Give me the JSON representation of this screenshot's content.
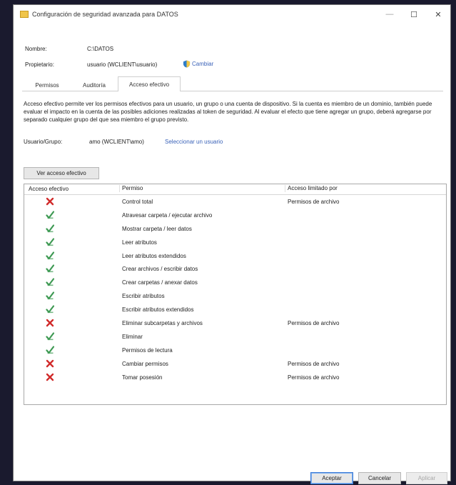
{
  "window": {
    "title": "Configuración de seguridad avanzada para DATOS",
    "minimize": "—",
    "maximize": "☐",
    "close": "✕"
  },
  "info": {
    "name_label": "Nombre:",
    "name_value": "C:\\DATOS",
    "owner_label": "Propietario:",
    "owner_value": "usuario (WCLIENT\\usuario)",
    "owner_change_link": "Cambiar"
  },
  "tabs": [
    {
      "label": "Permisos"
    },
    {
      "label": "Auditoría"
    },
    {
      "label": "Acceso efectivo"
    }
  ],
  "description": "Acceso efectivo permite ver los permisos efectivos para un usuario, un grupo o una cuenta de dispositivo. Si la cuenta es miembro de un dominio, también puede evaluar el impacto en la cuenta de las posibles adiciones realizadas al token de seguridad. Al evaluar el efecto que tiene agregar un grupo, deberá agregarse por separado cualquier grupo del que sea miembro el grupo previsto.",
  "user": {
    "label": "Usuario/Grupo:",
    "value": "amo (WCLIENT\\amo)",
    "select_link": "Seleccionar un usuario"
  },
  "view_button": "Ver acceso efectivo",
  "table": {
    "columns": [
      "Acceso efectivo",
      "Permiso",
      "Acceso limitado por"
    ],
    "rows": [
      {
        "allowed": false,
        "permission": "Control total",
        "limited_by": "Permisos de archivo"
      },
      {
        "allowed": true,
        "permission": "Atravesar carpeta / ejecutar archivo",
        "limited_by": ""
      },
      {
        "allowed": true,
        "permission": "Mostrar carpeta / leer datos",
        "limited_by": ""
      },
      {
        "allowed": true,
        "permission": "Leer atributos",
        "limited_by": ""
      },
      {
        "allowed": true,
        "permission": "Leer atributos extendidos",
        "limited_by": ""
      },
      {
        "allowed": true,
        "permission": "Crear archivos / escribir datos",
        "limited_by": ""
      },
      {
        "allowed": true,
        "permission": "Crear carpetas / anexar datos",
        "limited_by": ""
      },
      {
        "allowed": true,
        "permission": "Escribir atributos",
        "limited_by": ""
      },
      {
        "allowed": true,
        "permission": "Escribir atributos extendidos",
        "limited_by": ""
      },
      {
        "allowed": false,
        "permission": "Eliminar subcarpetas y archivos",
        "limited_by": "Permisos de archivo"
      },
      {
        "allowed": true,
        "permission": "Eliminar",
        "limited_by": ""
      },
      {
        "allowed": true,
        "permission": "Permisos de lectura",
        "limited_by": ""
      },
      {
        "allowed": false,
        "permission": "Cambiar permisos",
        "limited_by": "Permisos de archivo"
      },
      {
        "allowed": false,
        "permission": "Tomar posesión",
        "limited_by": "Permisos de archivo"
      }
    ]
  },
  "footer": {
    "accept": "Aceptar",
    "cancel": "Cancelar",
    "apply": "Aplicar"
  },
  "colors": {
    "deny": "#d12b2b",
    "allow": "#3f9a54",
    "link": "#3a62b8"
  },
  "icons": {
    "allow": "green-check-icon",
    "deny": "red-x-icon",
    "owner_change": "shield-icon",
    "title": "folder-icon"
  }
}
